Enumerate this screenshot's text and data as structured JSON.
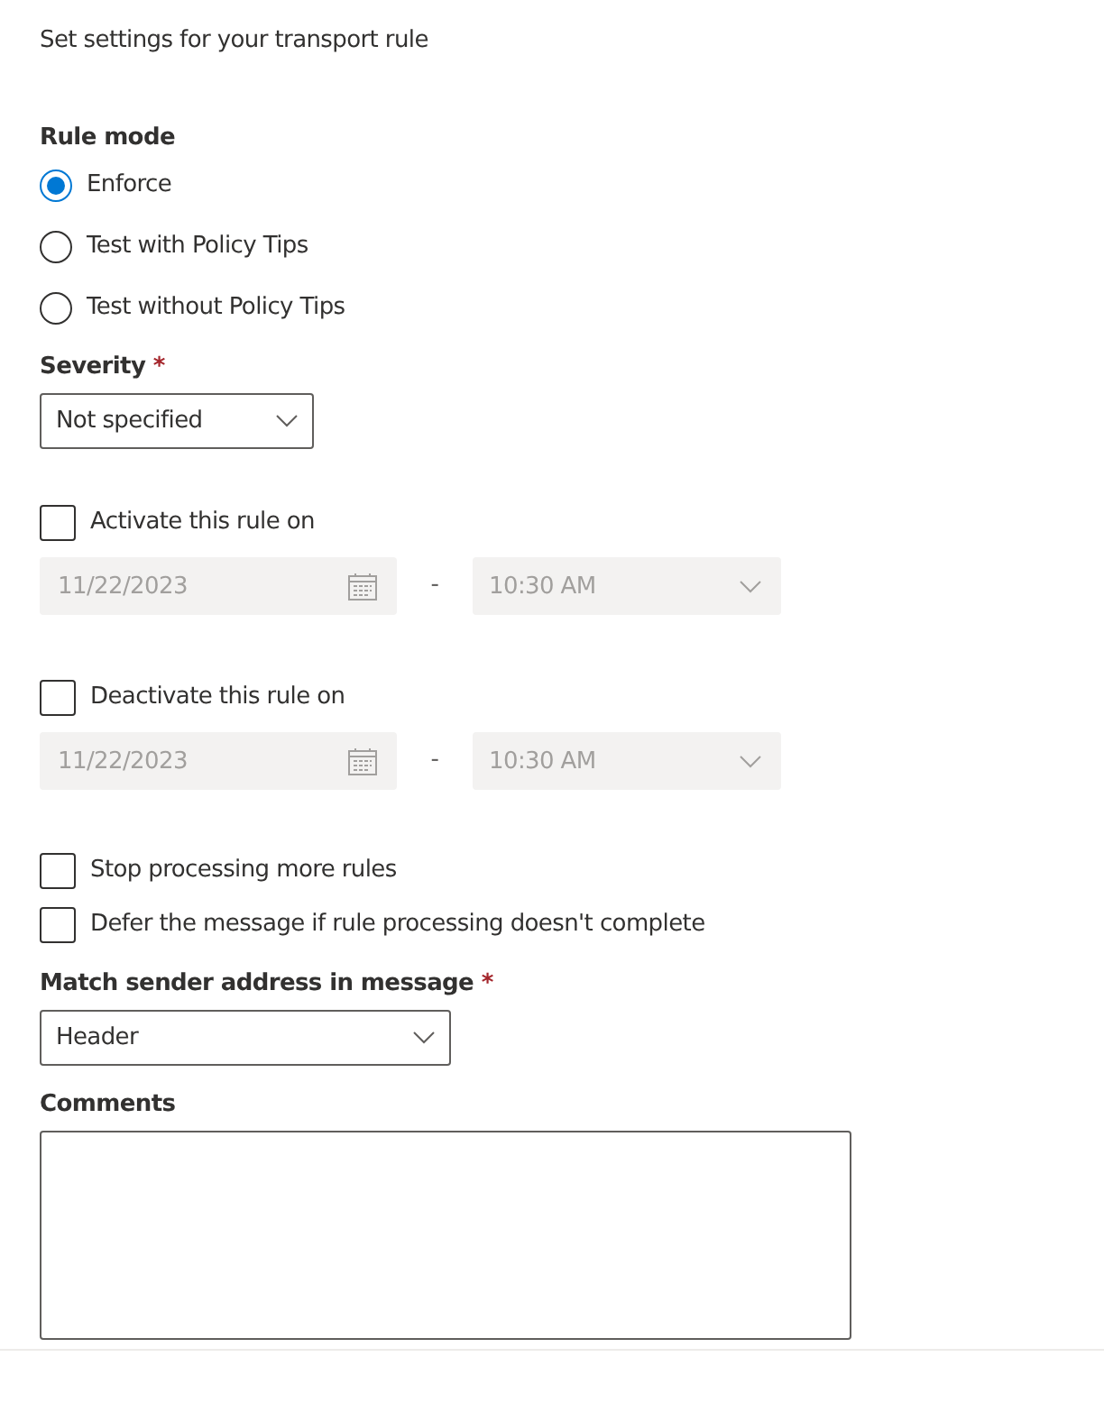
{
  "heading": "Set settings for your transport rule",
  "rule_mode": {
    "label": "Rule mode",
    "options": [
      {
        "label": "Enforce",
        "selected": true
      },
      {
        "label": "Test with Policy Tips",
        "selected": false
      },
      {
        "label": "Test without Policy Tips",
        "selected": false
      }
    ]
  },
  "severity": {
    "label": "Severity",
    "required_mark": "*",
    "value": "Not specified"
  },
  "schedules": [
    {
      "label": "Activate this rule on",
      "checked": false,
      "date": "11/22/2023",
      "separator": "-",
      "time": "10:30 AM",
      "disabled": true
    },
    {
      "label": "Deactivate this rule on",
      "checked": false,
      "date": "11/22/2023",
      "separator": "-",
      "time": "10:30 AM",
      "disabled": true
    }
  ],
  "options": [
    {
      "label": "Stop processing more rules",
      "checked": false
    },
    {
      "label": "Defer the message if rule processing doesn't complete",
      "checked": false
    }
  ],
  "match_sender": {
    "label": "Match sender address in message",
    "required_mark": "*",
    "value": "Header"
  },
  "comments": {
    "label": "Comments"
  }
}
